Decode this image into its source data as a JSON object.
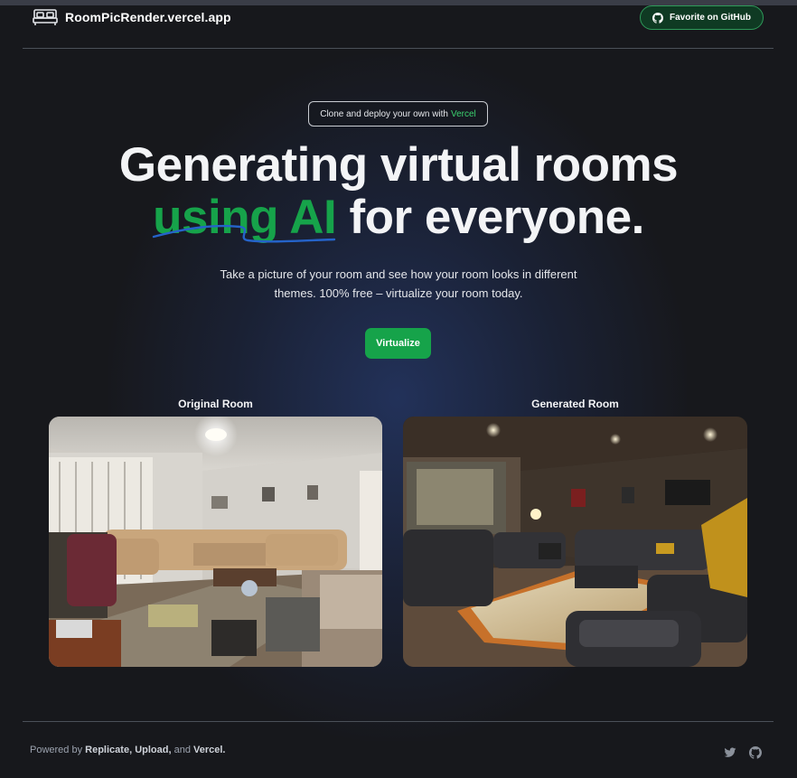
{
  "header": {
    "app_name": "RoomPicRender.vercel.app",
    "github_button": "Favorite on GitHub"
  },
  "hero": {
    "clone_prefix": "Clone and deploy your own with",
    "clone_link": "Vercel",
    "title_line1": "Generating virtual rooms",
    "title_green": "using AI",
    "title_rest": " for everyone.",
    "subtitle_line1": "Take a picture of your room and see how your room looks in different",
    "subtitle_line2": "themes. 100% free – virtualize your room today.",
    "cta": "Virtualize"
  },
  "comparison": {
    "original_caption": "Original Room",
    "generated_caption": "Generated Room"
  },
  "footer": {
    "prefix": "Powered by",
    "replicate": "Replicate,",
    "upload": "Upload,",
    "and": "and",
    "vercel": "Vercel."
  },
  "icons": {
    "logo": "bed-icon",
    "github": "github-icon",
    "twitter": "twitter-icon"
  },
  "colors": {
    "accent_green": "#16a34a",
    "background": "#17181c"
  }
}
